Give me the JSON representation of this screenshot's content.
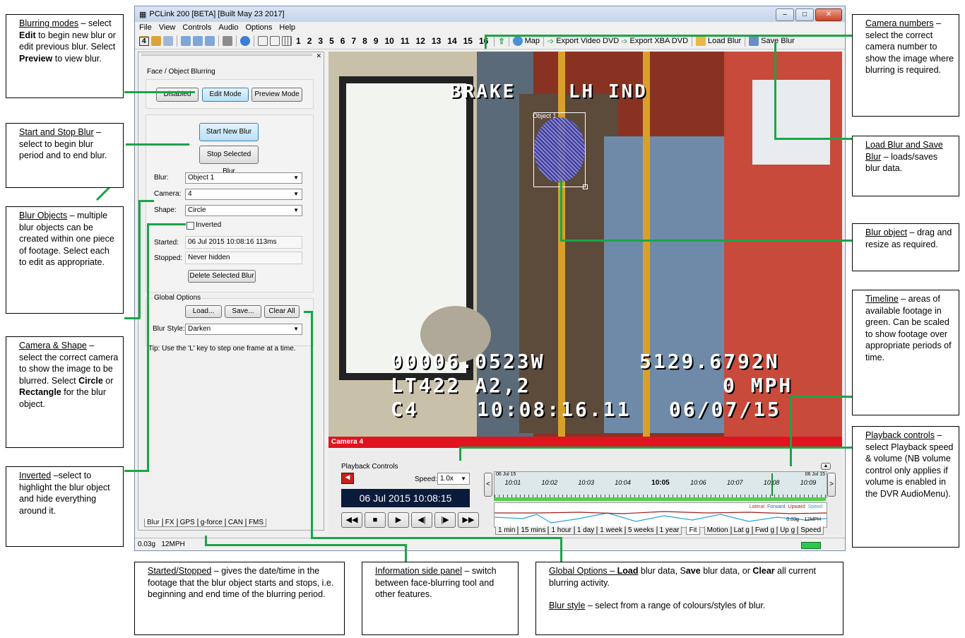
{
  "window": {
    "title": "PCLink 200 [BETA] [Built May 23 2017]",
    "menu": [
      "File",
      "View",
      "Controls",
      "Audio",
      "Options",
      "Help"
    ],
    "camera_numbers": [
      "1",
      "2",
      "3",
      "4",
      "5",
      "6",
      "7",
      "8",
      "9",
      "10",
      "11",
      "12",
      "13",
      "14",
      "15",
      "16"
    ],
    "selected_camera": "4",
    "toolbar_buttons": {
      "map": "Map",
      "export_video": "Export Video DVD",
      "export_xba": "Export XBA DVD",
      "load_blur": "Load Blur",
      "save_blur": "Save Blur"
    }
  },
  "left_panel": {
    "section_title": "Face / Object Blurring",
    "modes": {
      "disabled": "Disabled",
      "edit": "Edit Mode",
      "preview": "Preview Mode"
    },
    "start_blur": "Start New Blur",
    "stop_blur": "Stop Selected Blur",
    "blur_label": "Blur:",
    "blur_value": "Object 1",
    "camera_label": "Camera:",
    "camera_value": "4",
    "shape_label": "Shape:",
    "shape_value": "Circle",
    "inverted_label": "Inverted",
    "started_label": "Started:",
    "started_value": "06 Jul 2015  10:08:16 113ms",
    "stopped_label": "Stopped:",
    "stopped_value": "Never hidden",
    "delete_blur": "Delete Selected Blur",
    "global_options": "Global Options",
    "load": "Load...",
    "save": "Save...",
    "clear_all": "Clear All",
    "blur_style_label": "Blur Style:",
    "blur_style_value": "Darken",
    "tip": "Tip: Use the 'L' key to step one frame at a time.",
    "tabs": [
      "Blur",
      "FX",
      "GPS",
      "g-force",
      "CAN",
      "FMS"
    ]
  },
  "video": {
    "osd_top": "BRAKE    LH IND",
    "object_label": "Object 1",
    "osd_line1_left": "00006.0523W",
    "osd_line1_right": "5129.6792N",
    "osd_line2_left": "LT422 A2,2",
    "osd_line2_right": "0 MPH",
    "osd_line3_left": "C4",
    "osd_line3_mid": "10:08:16.11",
    "osd_line3_right": "06/07/15",
    "camera_label": "Camera 4"
  },
  "playback": {
    "title": "Playback Controls",
    "speed_label": "Speed:",
    "speed_value": "1.0x",
    "datetime": "06 Jul 2015  10:08:15",
    "timeline_date_left": "06 Jul 15",
    "timeline_date_right": "06 Jul 15",
    "ticks": [
      "10:01",
      "10:02",
      "10:03",
      "10:04",
      "10:05",
      "10:06",
      "10:07",
      "10:08",
      "10:09"
    ],
    "graph_legend": [
      "Lateral",
      "Forward",
      "Upward",
      "Speed"
    ],
    "graph_readout": "0.03g    12MPH",
    "scale_tabs": [
      "1 min",
      "15 mins",
      "1 hour",
      "1 day",
      "1 week",
      "5 weeks",
      "1 year",
      "Fit"
    ],
    "graph_tabs": [
      "Motion",
      "Lat g",
      "Fwd g",
      "Up g",
      "Speed"
    ]
  },
  "status": {
    "text": "0.03g   12MPH"
  },
  "callouts": {
    "blurring_modes": {
      "title": "Blurring modes",
      "text1": " – select ",
      "b1": "Edit",
      "text2": " to begin new blur or edit previous blur. Select ",
      "b2": "Preview",
      "text3": " to view blur."
    },
    "start_stop": {
      "title": "Start and Stop Blur",
      "text": " – select to begin blur period and to end blur."
    },
    "blur_objects": {
      "title": "Blur Objects",
      "text": " – multiple blur objects can be created within one piece of footage. Select each to edit as appropriate."
    },
    "camera_shape": {
      "title": "Camera & Shape",
      "text1": " – select the correct camera to show the image to be blurred.   Select ",
      "b1": "Circle",
      "text2": " or ",
      "b2": "Rectangle",
      "text3": " for the blur object."
    },
    "inverted": {
      "title": "Inverted",
      "text": " –select to highlight the blur object and hide everything around it."
    },
    "started_stopped": {
      "title": "Started/Stopped",
      "text": " – gives the date/time in the footage that the blur object starts and stops, i.e. beginning and end time of the blurring period."
    },
    "info_panel": {
      "title": "Information side panel",
      "text": " – switch between face-blurring tool and other features."
    },
    "global_options": {
      "title": "Global Options – ",
      "b1": "Load",
      "t1": " blur data, S",
      "b2": "ave",
      "t2": " blur data, or ",
      "b3": "Clear",
      "t3": " all current blurring activity.",
      "style_title": "Blur style",
      "style_text": " – select from a range of colours/styles of blur."
    },
    "camera_numbers": {
      "title": "Camera numbers",
      "text": " – select the correct camera number to show the image where blurring is required."
    },
    "load_save": {
      "title": "Load Blur and Save Blur",
      "text": " – loads/saves blur data."
    },
    "blur_object": {
      "title": "Blur object",
      "text": " – drag and resize as required."
    },
    "timeline": {
      "title": "Timeline",
      "text": " – areas of available footage in green. Can be scaled to show footage over appropriate periods of time."
    },
    "playback": {
      "title": "Playback controls",
      "text": " – select Playback speed & volume (NB volume control only applies if volume is enabled in the DVR AudioMenu)."
    }
  }
}
